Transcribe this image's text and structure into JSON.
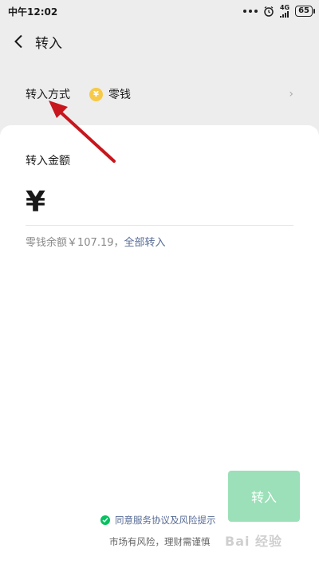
{
  "status_bar": {
    "time": "中午12:02",
    "network": "4G",
    "battery": "65"
  },
  "nav": {
    "title": "转入",
    "back_icon": "chevron-left-icon"
  },
  "method": {
    "label": "转入方式",
    "coin_symbol": "¥",
    "value": "零钱",
    "chevron": "›"
  },
  "amount": {
    "label": "转入金额",
    "currency": "¥",
    "value": ""
  },
  "balance": {
    "text": "零钱余额￥107.19，",
    "transfer_all": "全部转入"
  },
  "submit": {
    "label": "转入"
  },
  "agreement": {
    "text": "同意服务协议及风险提示"
  },
  "risk_note": "市场有风险，理财需谨慎",
  "watermark": "Bai 经验",
  "colors": {
    "accent_green": "#07c160",
    "button_disabled": "#9be0b8",
    "link_blue": "#576b95",
    "annotation_arrow": "#c8161d",
    "coin_yellow": "#f7c948"
  }
}
